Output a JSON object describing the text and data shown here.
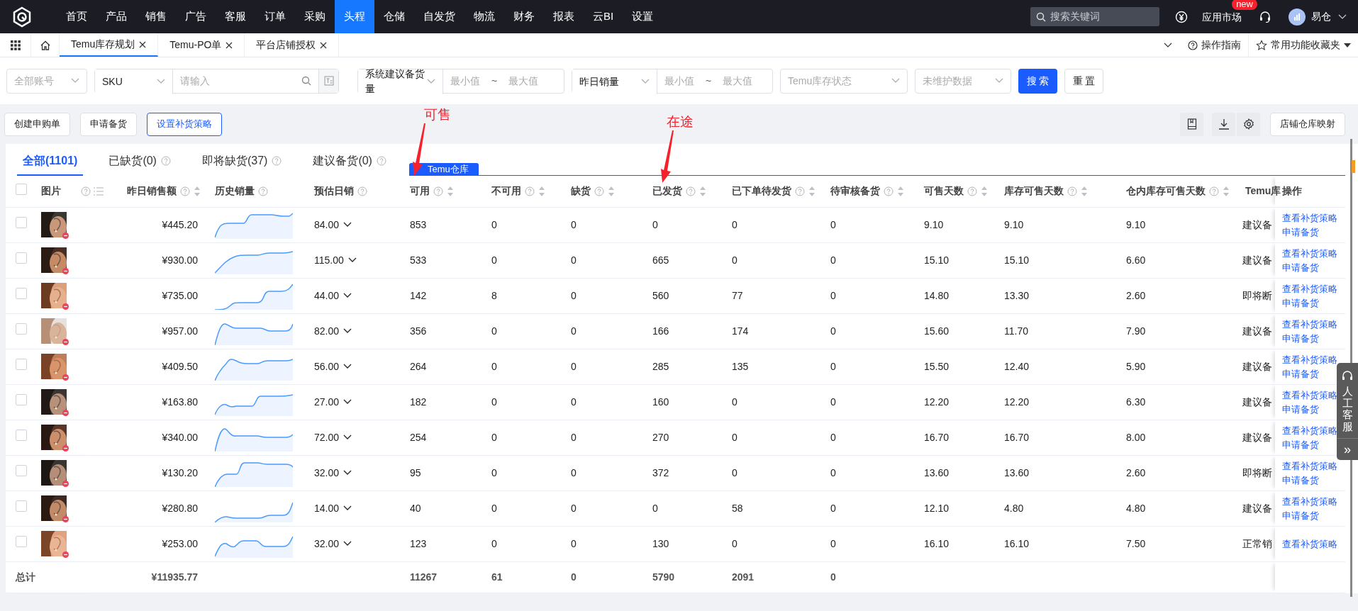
{
  "nav": {
    "items": [
      {
        "label": "首页",
        "selected": false
      },
      {
        "label": "产品",
        "selected": false
      },
      {
        "label": "销售",
        "selected": false
      },
      {
        "label": "广告",
        "selected": false
      },
      {
        "label": "客服",
        "selected": false
      },
      {
        "label": "订单",
        "selected": false
      },
      {
        "label": "采购",
        "selected": false
      },
      {
        "label": "头程",
        "selected": true
      },
      {
        "label": "仓储",
        "selected": false
      },
      {
        "label": "自发货",
        "selected": false
      },
      {
        "label": "物流",
        "selected": false
      },
      {
        "label": "财务",
        "selected": false
      },
      {
        "label": "报表",
        "selected": false
      },
      {
        "label": "云BI",
        "selected": false
      },
      {
        "label": "设置",
        "selected": false
      }
    ],
    "search_placeholder": "搜索关键词",
    "app_market": "应用市场",
    "badge": "new",
    "user": "易仓"
  },
  "tabs": [
    {
      "label": "Temu库存规划",
      "selected": true
    },
    {
      "label": "Temu-PO单",
      "selected": false
    },
    {
      "label": "平台店铺授权",
      "selected": false
    }
  ],
  "guide": "操作指南",
  "favorites": "常用功能收藏夹",
  "filters": {
    "account": {
      "placeholder": "全部账号"
    },
    "sku": {
      "value": "SKU",
      "placeholder": "请输入"
    },
    "suggest": {
      "value": "系统建议备货量",
      "min_placeholder": "最小值",
      "separator": "~",
      "max_placeholder": "最大值"
    },
    "yesterday": {
      "value": "昨日销量",
      "min_placeholder": "最小值",
      "separator": "~",
      "max_placeholder": "最大值"
    },
    "status": {
      "placeholder": "Temu库存状态"
    },
    "data": {
      "placeholder": "未维护数据"
    },
    "search_button": "搜 索",
    "reset_button": "重 置"
  },
  "actions": [
    {
      "label": "创建申购单",
      "kind": "default"
    },
    {
      "label": "申请备货",
      "kind": "default"
    },
    {
      "label": "设置补货策略",
      "kind": "outline"
    }
  ],
  "mapping_button": "店铺仓库映射",
  "annotations": [
    {
      "text": "可售"
    },
    {
      "text": "在途"
    }
  ],
  "status_tabs": [
    {
      "label": "全部(1101)",
      "selected": true,
      "help": false
    },
    {
      "label": "已缺货(0)",
      "selected": false,
      "help": true
    },
    {
      "label": "即将缺货(37)",
      "selected": false,
      "help": true
    },
    {
      "label": "建议备货(0)",
      "selected": false,
      "help": true
    }
  ],
  "warehouse_tag": "Temu仓库",
  "table": {
    "select_all": {
      "checked": false
    },
    "image_column": "图片",
    "tools_column": {
      "help": true
    },
    "ops_column": "操作",
    "columns": [
      {
        "kind": "money",
        "label": "昨日销售额",
        "help": true,
        "sortable": true
      },
      {
        "kind": "spark",
        "label": "历史销量",
        "help": true,
        "sortable": false
      },
      {
        "kind": "forecast",
        "label": "预估日销",
        "help": true,
        "sortable": false
      },
      {
        "kind": "text",
        "label": "可用",
        "help": true,
        "sortable": true
      },
      {
        "kind": "text",
        "label": "不可用",
        "help": true,
        "sortable": true
      },
      {
        "kind": "text",
        "label": "缺货",
        "help": true,
        "sortable": true
      },
      {
        "kind": "text",
        "label": "已发货",
        "help": true,
        "sortable": true
      },
      {
        "kind": "text",
        "label": "已下单待发货",
        "help": true,
        "sortable": true
      },
      {
        "kind": "text",
        "label": "待审核备货",
        "help": true,
        "sortable": true
      },
      {
        "kind": "text",
        "label": "可售天数",
        "help": true,
        "sortable": true
      },
      {
        "kind": "text",
        "label": "库存可售天数",
        "help": true,
        "sortable": true
      },
      {
        "kind": "text",
        "label": "仓内库存可售天数",
        "help": true,
        "sortable": true
      },
      {
        "kind": "text",
        "label": "Temu库"
      }
    ],
    "rows": [
      {
        "checked": false,
        "cells": [
          "¥445.20",
          "",
          "84.00",
          "853",
          "0",
          "0",
          "0",
          "0",
          "0",
          "9.10",
          "9.10",
          "9.10",
          "建议备"
        ],
        "ops": [
          "查看补货策略",
          "申请备货"
        ]
      },
      {
        "checked": false,
        "cells": [
          "¥930.00",
          "",
          "115.00",
          "533",
          "0",
          "0",
          "665",
          "0",
          "0",
          "15.10",
          "15.10",
          "6.60",
          "建议备"
        ],
        "ops": [
          "查看补货策略",
          "申请备货"
        ]
      },
      {
        "checked": false,
        "cells": [
          "¥735.00",
          "",
          "44.00",
          "142",
          "8",
          "0",
          "560",
          "77",
          "0",
          "14.80",
          "13.30",
          "2.60",
          "即将断"
        ],
        "ops": [
          "查看补货策略",
          "申请备货"
        ]
      },
      {
        "checked": false,
        "cells": [
          "¥957.00",
          "",
          "82.00",
          "356",
          "0",
          "0",
          "166",
          "174",
          "0",
          "15.60",
          "11.70",
          "7.90",
          "建议备"
        ],
        "ops": [
          "查看补货策略",
          "申请备货"
        ]
      },
      {
        "checked": false,
        "cells": [
          "¥409.50",
          "",
          "56.00",
          "264",
          "0",
          "0",
          "285",
          "135",
          "0",
          "15.50",
          "12.40",
          "5.90",
          "建议备"
        ],
        "ops": [
          "查看补货策略",
          "申请备货"
        ]
      },
      {
        "checked": false,
        "cells": [
          "¥163.80",
          "",
          "27.00",
          "182",
          "0",
          "0",
          "160",
          "0",
          "0",
          "12.20",
          "12.20",
          "6.30",
          "建议备"
        ],
        "ops": [
          "查看补货策略",
          "申请备货"
        ]
      },
      {
        "checked": false,
        "cells": [
          "¥340.00",
          "",
          "72.00",
          "254",
          "0",
          "0",
          "270",
          "0",
          "0",
          "16.70",
          "16.70",
          "8.00",
          "建议备"
        ],
        "ops": [
          "查看补货策略",
          "申请备货"
        ]
      },
      {
        "checked": false,
        "cells": [
          "¥130.20",
          "",
          "32.00",
          "95",
          "0",
          "0",
          "372",
          "0",
          "0",
          "13.60",
          "13.60",
          "2.60",
          "即将断"
        ],
        "ops": [
          "查看补货策略",
          "申请备货"
        ]
      },
      {
        "checked": false,
        "cells": [
          "¥280.80",
          "",
          "14.00",
          "40",
          "0",
          "0",
          "0",
          "58",
          "0",
          "12.10",
          "4.80",
          "4.80",
          "建议备"
        ],
        "ops": [
          "查看补货策略",
          "申请备货"
        ]
      },
      {
        "checked": false,
        "cells": [
          "¥253.00",
          "",
          "32.00",
          "123",
          "0",
          "0",
          "130",
          "0",
          "0",
          "16.10",
          "16.10",
          "7.50",
          "正常销"
        ],
        "ops": [
          "查看补货策略"
        ]
      }
    ],
    "totals": {
      "label": "总计",
      "cells": [
        "¥11935.77",
        "",
        "",
        "11267",
        "61",
        "0",
        "5790",
        "2091",
        "0"
      ]
    }
  },
  "service_widget": {
    "label": "人工客服",
    "collapse": "»"
  }
}
